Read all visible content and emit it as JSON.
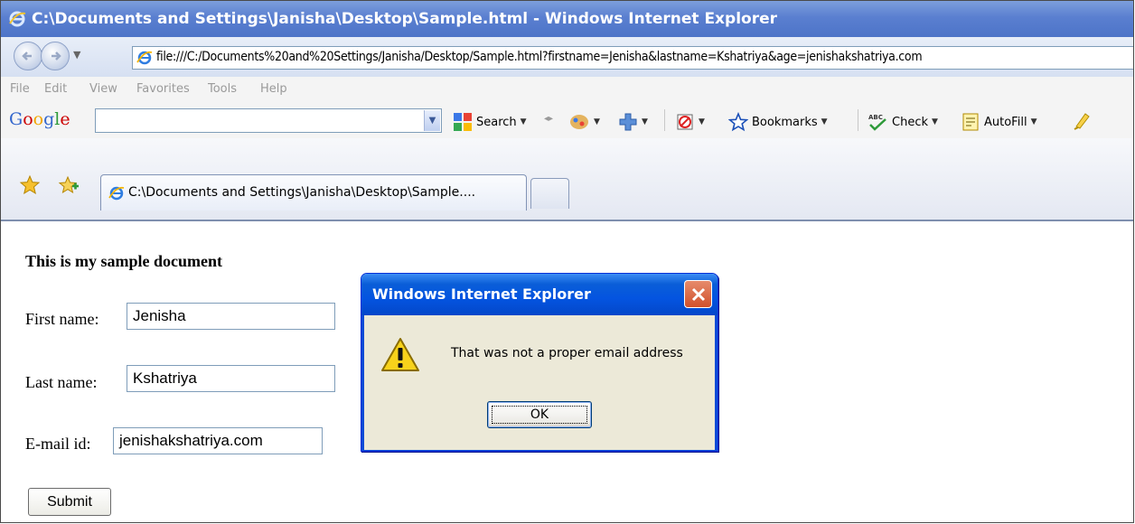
{
  "window": {
    "title": "C:\\Documents and Settings\\Janisha\\Desktop\\Sample.html - Windows Internet Explorer"
  },
  "address_bar": {
    "url": "file:///C:/Documents%20and%20Settings/Janisha/Desktop/Sample.html?firstname=Jenisha&lastname=Kshatriya&age=jenishakshatriya.com"
  },
  "menu": {
    "items": [
      "File",
      "Edit",
      "View",
      "Favorites",
      "Tools",
      "Help"
    ]
  },
  "google_toolbar": {
    "logo": "Google",
    "search_value": "",
    "search_label": "Search",
    "bookmarks_label": "Bookmarks",
    "check_label": "Check",
    "autofill_label": "AutoFill"
  },
  "tabs": [
    {
      "label": "C:\\Documents and Settings\\Janisha\\Desktop\\Sample...."
    }
  ],
  "page": {
    "heading": "This is my sample document",
    "first_name_label": "First name:",
    "first_name_value": "Jenisha",
    "last_name_label": "Last name:",
    "last_name_value": "Kshatriya",
    "email_label": "E-mail id:",
    "email_value": "jenishakshatriya.com",
    "submit_label": "Submit"
  },
  "dialog": {
    "title": "Windows Internet Explorer",
    "message": "That was not a proper email address",
    "ok_label": "OK",
    "icon": "warning-icon"
  },
  "colors": {
    "titlebar": "#5a7fd0",
    "dialog_title": "#0454e0",
    "dialog_body": "#ece9d8",
    "close_button": "#d1502b"
  }
}
